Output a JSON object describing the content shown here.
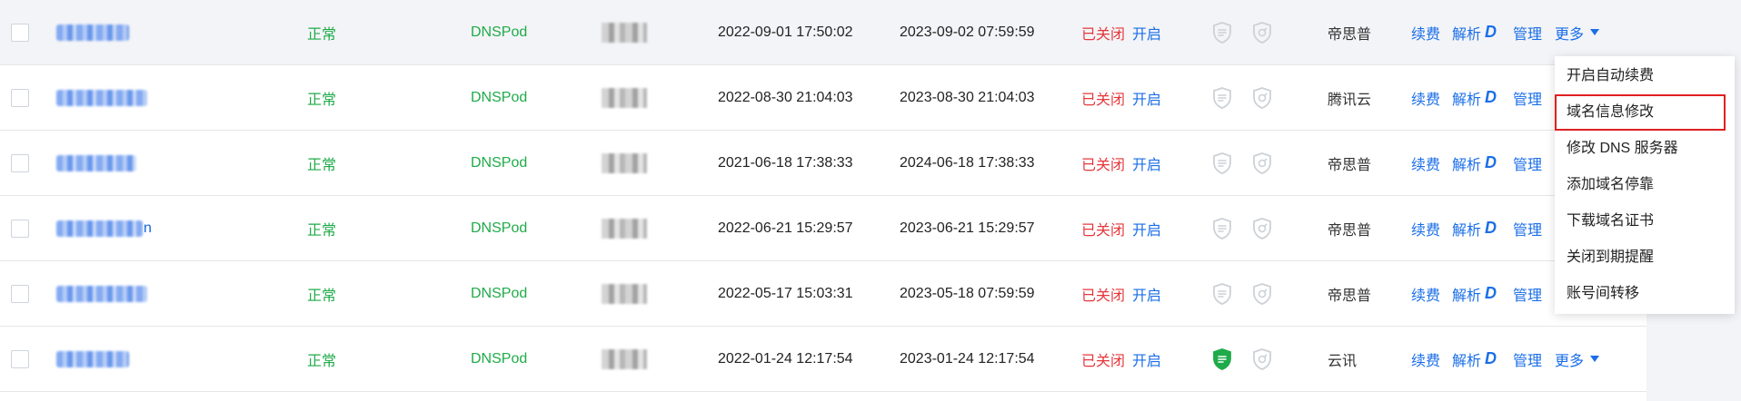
{
  "rows": [
    {
      "status": "正常",
      "dns": "DNSPod",
      "registered": "2022-09-01 17:50:02",
      "expires": "2023-09-02 07:59:59",
      "auto_renew": "已关闭",
      "auto_renew_action": "开启",
      "shield_active": false,
      "registrar": "帝思普",
      "renew": "续费",
      "resolve": "解析",
      "manage": "管理",
      "more": "更多",
      "name_tail": ""
    },
    {
      "status": "正常",
      "dns": "DNSPod",
      "registered": "2022-08-30 21:04:03",
      "expires": "2023-08-30 21:04:03",
      "auto_renew": "已关闭",
      "auto_renew_action": "开启",
      "shield_active": false,
      "registrar": "腾讯云",
      "renew": "续费",
      "resolve": "解析",
      "manage": "管理",
      "more": "",
      "name_tail": ""
    },
    {
      "status": "正常",
      "dns": "DNSPod",
      "registered": "2021-06-18 17:38:33",
      "expires": "2024-06-18 17:38:33",
      "auto_renew": "已关闭",
      "auto_renew_action": "开启",
      "shield_active": false,
      "registrar": "帝思普",
      "renew": "续费",
      "resolve": "解析",
      "manage": "管理",
      "more": "",
      "name_tail": ""
    },
    {
      "status": "正常",
      "dns": "DNSPod",
      "registered": "2022-06-21 15:29:57",
      "expires": "2023-06-21 15:29:57",
      "auto_renew": "已关闭",
      "auto_renew_action": "开启",
      "shield_active": false,
      "registrar": "帝思普",
      "renew": "续费",
      "resolve": "解析",
      "manage": "管理",
      "more": "",
      "name_tail": "n"
    },
    {
      "status": "正常",
      "dns": "DNSPod",
      "registered": "2022-05-17 15:03:31",
      "expires": "2023-05-18 07:59:59",
      "auto_renew": "已关闭",
      "auto_renew_action": "开启",
      "shield_active": false,
      "registrar": "帝思普",
      "renew": "续费",
      "resolve": "解析",
      "manage": "管理",
      "more": "",
      "name_tail": ""
    },
    {
      "status": "正常",
      "dns": "DNSPod",
      "registered": "2022-01-24 12:17:54",
      "expires": "2023-01-24 12:17:54",
      "auto_renew": "已关闭",
      "auto_renew_action": "开启",
      "shield_active": true,
      "registrar": "云讯",
      "renew": "续费",
      "resolve": "解析",
      "manage": "管理",
      "more": "更多",
      "name_tail": ""
    }
  ],
  "resolve_badge": "D",
  "dropdown": {
    "items": [
      "开启自动续费",
      "域名信息修改",
      "修改 DNS 服务器",
      "添加域名停靠",
      "下载域名证书",
      "关闭到期提醒",
      "账号间转移"
    ],
    "highlighted": 1
  },
  "colors": {
    "link": "#1a6ee8",
    "ok_green": "#1fab49",
    "closed_red": "#e5373c",
    "highlight_border": "#e02020",
    "hover_row": "#f3f4f7"
  },
  "icons": [
    "checkbox",
    "shield-icon",
    "lock-shield-icon",
    "caret-down-icon"
  ]
}
